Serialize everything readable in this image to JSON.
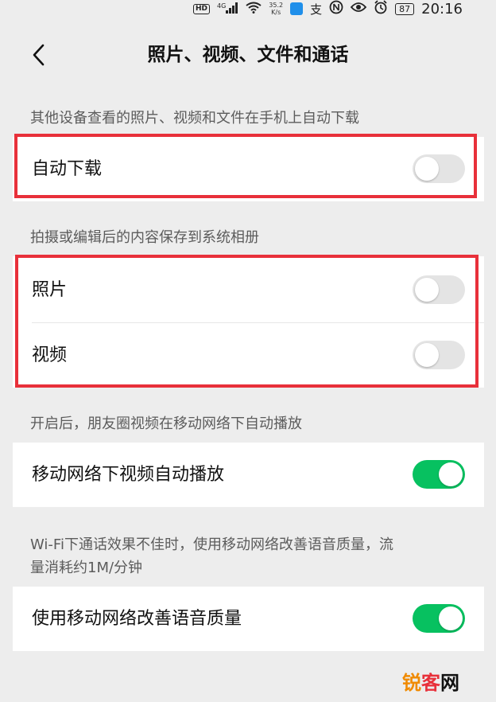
{
  "status_bar": {
    "hd_badge": "HD",
    "signal_label": "4G",
    "net_speed_value": "35.2",
    "net_speed_unit": "K/s",
    "app_glyph": "支",
    "battery": "87",
    "time": "20:16"
  },
  "nav": {
    "back_icon": "chevron-left-icon",
    "title": "照片、视频、文件和通话"
  },
  "section_auto_download": {
    "caption": "其他设备查看的照片、视频和文件在手机上自动下载",
    "rows": [
      {
        "label": "自动下载",
        "enabled": false
      }
    ]
  },
  "section_save_album": {
    "caption": "拍摄或编辑后的内容保存到系统相册",
    "rows": [
      {
        "label": "照片",
        "enabled": false
      },
      {
        "label": "视频",
        "enabled": false
      }
    ]
  },
  "section_moments": {
    "caption": "开启后，朋友圈视频在移动网络下自动播放",
    "rows": [
      {
        "label": "移动网络下视频自动播放",
        "enabled": true
      }
    ]
  },
  "section_voice": {
    "caption_line1": "Wi-Fi下通话效果不佳时，使用移动网络改善语音质量，流",
    "caption_line2": "量消耗约1M/分钟",
    "rows": [
      {
        "label": "使用移动网络改善语音质量",
        "enabled": true
      }
    ]
  },
  "watermark": {
    "part1": "锐",
    "part2": "客",
    "part3": "网"
  },
  "colors": {
    "background": "#ededed",
    "switch_on": "#07c160",
    "switch_off": "#e4e4e4",
    "highlight": "#e8303a"
  }
}
